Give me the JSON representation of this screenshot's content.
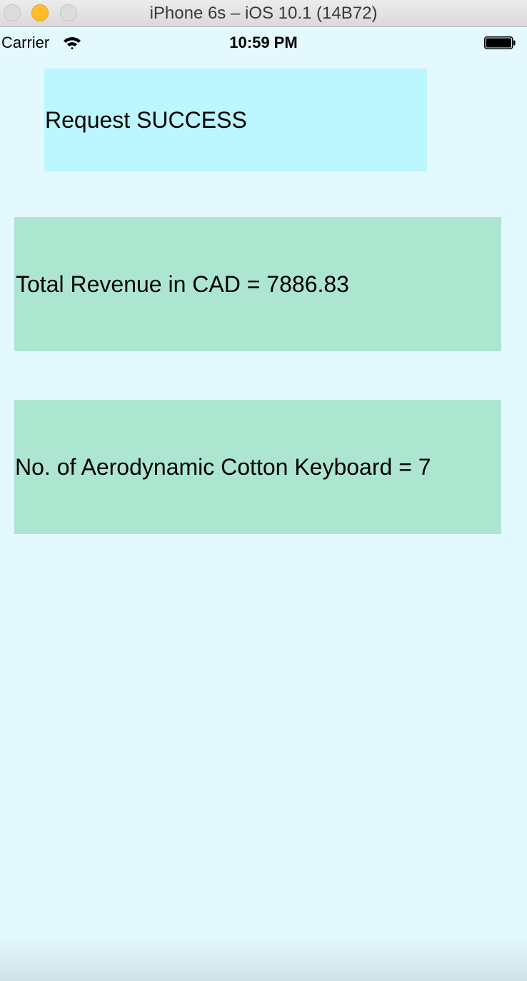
{
  "window": {
    "title": "iPhone 6s – iOS 10.1 (14B72)"
  },
  "status_bar": {
    "carrier": "Carrier",
    "time": "10:59 PM",
    "icons": [
      "wifi-icon",
      "battery-icon"
    ]
  },
  "content": {
    "request_status": "Request SUCCESS",
    "revenue_text": "Total Revenue in CAD = 7886.83",
    "count_text": "No. of Aerodynamic Cotton Keyboard = 7"
  },
  "colors": {
    "background": "#e3f9fd",
    "status_box": "#bcf6fe",
    "result_box": "#ace6d1",
    "minimize_button": "#ffbd2e"
  }
}
